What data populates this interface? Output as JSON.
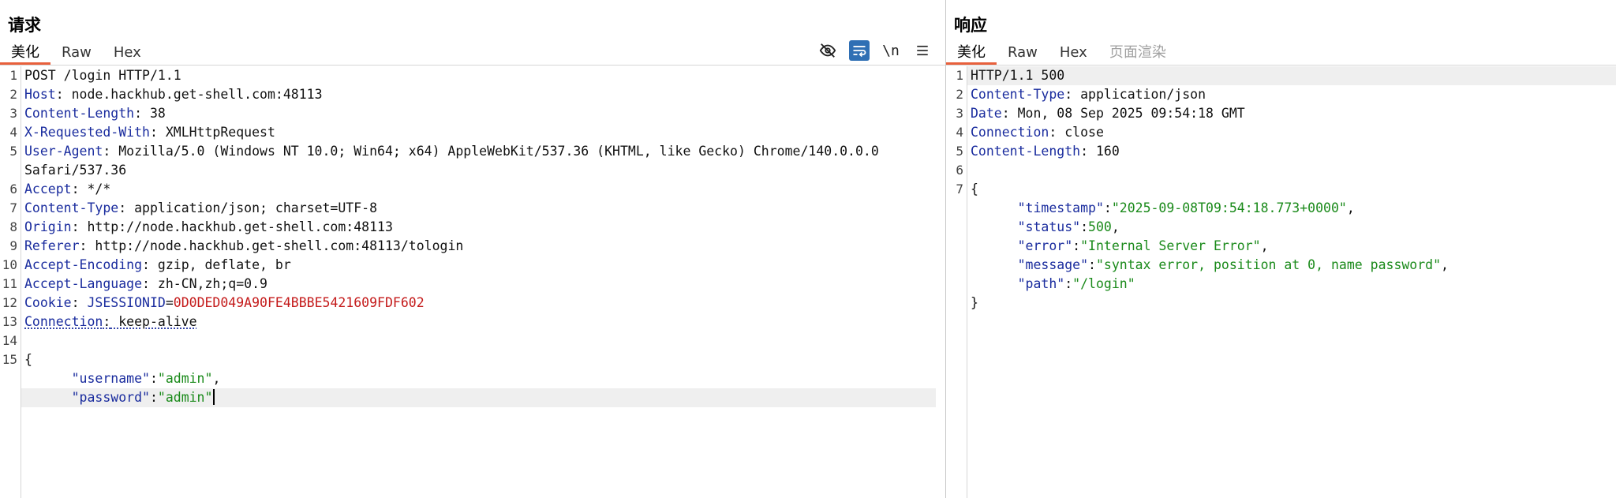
{
  "request": {
    "title": "请求",
    "tabs": [
      "美化",
      "Raw",
      "Hex"
    ],
    "active_tab": 0,
    "toolbar": {
      "hide_icon": "eye-off-icon",
      "wrap_icon": "word-wrap-icon",
      "newline_label": "\\n",
      "menu_icon": "menu-icon"
    },
    "lines": {
      "l1": "POST /login HTTP/1.1",
      "l2k": "Host",
      "l2v": " node.hackhub.get-shell.com:48113",
      "l3k": "Content-Length",
      "l3v": " 38",
      "l4k": "X-Requested-With",
      "l4v": " XMLHttpRequest",
      "l5k": "User-Agent",
      "l5v": " Mozilla/5.0 (Windows NT 10.0; Win64; x64) AppleWebKit/537.36 (KHTML, like Gecko) Chrome/140.0.0.0",
      "l5cont": "Safari/537.36",
      "l6k": "Accept",
      "l6v": " */*",
      "l7k": "Content-Type",
      "l7v": " application/json; charset=UTF-8",
      "l8k": "Origin",
      "l8v": " http://node.hackhub.get-shell.com:48113",
      "l9k": "Referer",
      "l9v": " http://node.hackhub.get-shell.com:48113/tologin",
      "l10k": "Accept-Encoding",
      "l10v": " gzip, deflate, br",
      "l11k": "Accept-Language",
      "l11v": " zh-CN,zh;q=0.9",
      "l12k": "Cookie",
      "l12ck": "JSESSIONID",
      "l12cv": "0D0DED049A90FE4BBBE5421609FDF602",
      "l13k": "Connection",
      "l13v": " keep-alive",
      "l15": "{",
      "body_username_key": "\"username\"",
      "body_username_val": "\"admin\"",
      "body_password_key": "\"password\"",
      "body_password_val": "\"admin\""
    }
  },
  "response": {
    "title": "响应",
    "tabs": [
      "美化",
      "Raw",
      "Hex",
      "页面渲染"
    ],
    "active_tab": 0,
    "lines": {
      "l1": "HTTP/1.1 500",
      "l2k": "Content-Type",
      "l2v": " application/json",
      "l3k": "Date",
      "l3v": " Mon, 08 Sep 2025 09:54:18 GMT",
      "l4k": "Connection",
      "l4v": " close",
      "l5k": "Content-Length",
      "l5v": " 160",
      "l7": "{",
      "ts_k": "\"timestamp\"",
      "ts_v": "\"2025-09-08T09:54:18.773+0000\"",
      "st_k": "\"status\"",
      "st_v": "500",
      "er_k": "\"error\"",
      "er_v": "\"Internal Server Error\"",
      "ms_k": "\"message\"",
      "ms_v": "\"syntax error, position at 0, name password\"",
      "pa_k": "\"path\"",
      "pa_v": "\"/login\"",
      "close": "}"
    }
  },
  "line_numbers": {
    "n1": "1",
    "n2": "2",
    "n3": "3",
    "n4": "4",
    "n5": "5",
    "n6": "6",
    "n7": "7",
    "n8": "8",
    "n9": "9",
    "n10": "10",
    "n11": "11",
    "n12": "12",
    "n13": "13",
    "n14": "14",
    "n15": "15"
  },
  "punct": {
    "colon": ":",
    "comma": ",",
    "eq": "="
  },
  "colors": {
    "accent": "#e8603c",
    "header_key": "#1a2c9e",
    "json_string": "#1a8a1a",
    "cookie_value": "#c41a1a",
    "toggle_on": "#2f6fb4"
  }
}
